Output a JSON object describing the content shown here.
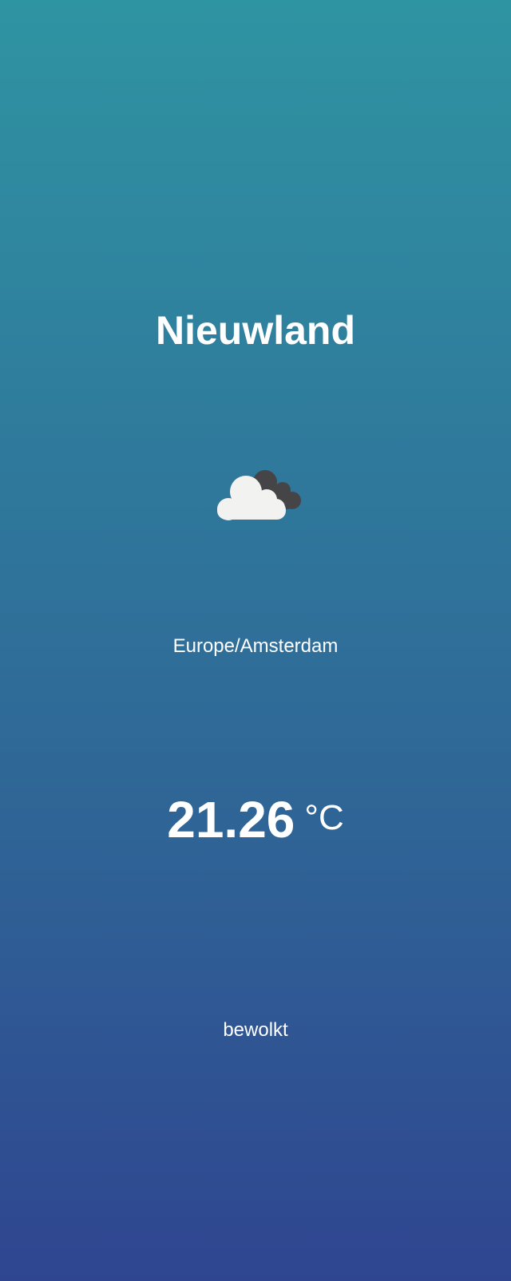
{
  "weather": {
    "city": "Nieuwland",
    "icon": "cloudy-icon",
    "timezone": "Europe/Amsterdam",
    "temperature": "21.26",
    "unit": "°C",
    "description": "bewolkt"
  },
  "colors": {
    "gradient_top": "#2f94a2",
    "gradient_bottom": "#2f4590",
    "text": "#ffffff",
    "cloud_front": "#f2f2f0",
    "cloud_back": "#454547"
  }
}
